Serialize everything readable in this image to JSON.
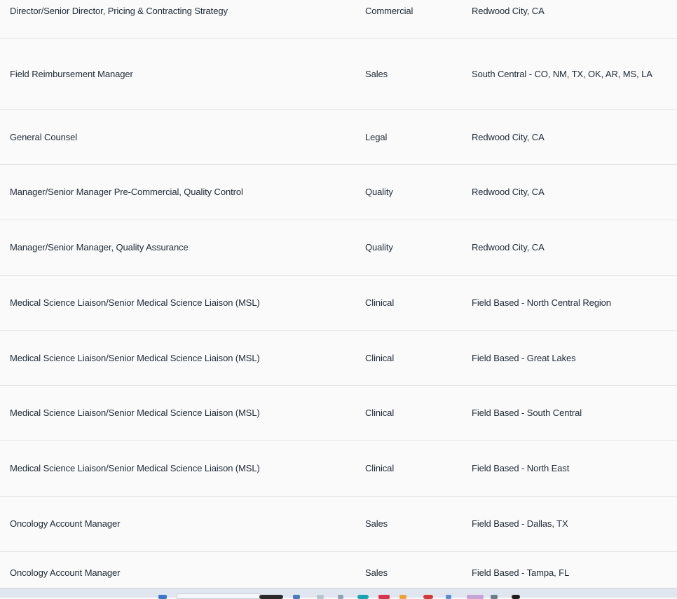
{
  "jobs": [
    {
      "title": "Director/Senior Director, Pricing & Contracting Strategy",
      "department": "Commercial",
      "location": "Redwood City, CA"
    },
    {
      "title": "Field Reimbursement Manager",
      "department": "Sales",
      "location": "South Central - CO, NM, TX, OK, AR, MS, LA"
    },
    {
      "title": "General Counsel",
      "department": "Legal",
      "location": "Redwood City, CA"
    },
    {
      "title": "Manager/Senior Manager Pre-Commercial, Quality Control",
      "department": "Quality",
      "location": "Redwood City, CA"
    },
    {
      "title": "Manager/Senior Manager, Quality Assurance",
      "department": "Quality",
      "location": "Redwood City, CA"
    },
    {
      "title": "Medical Science Liaison/Senior Medical Science Liaison (MSL)",
      "department": "Clinical",
      "location": "Field Based - North Central Region"
    },
    {
      "title": "Medical Science Liaison/Senior Medical Science Liaison (MSL)",
      "department": "Clinical",
      "location": "Field Based - Great Lakes"
    },
    {
      "title": "Medical Science Liaison/Senior Medical Science Liaison (MSL)",
      "department": "Clinical",
      "location": "Field Based - South Central"
    },
    {
      "title": "Medical Science Liaison/Senior Medical Science Liaison (MSL)",
      "department": "Clinical",
      "location": "Field Based - North East"
    },
    {
      "title": "Oncology Account Manager",
      "department": "Sales",
      "location": "Field Based - Dallas, TX"
    },
    {
      "title": "Oncology Account Manager",
      "department": "Sales",
      "location": "Field Based - Tampa, FL"
    }
  ],
  "taskbar": {
    "icons": [
      "start-icon",
      "search-box",
      "task-view-icon",
      "file-explorer-icon",
      "edge-icon",
      "chrome-icon",
      "mail-icon",
      "store-icon",
      "settings-icon",
      "app-icon",
      "app-icon-2",
      "app-icon-3"
    ]
  }
}
